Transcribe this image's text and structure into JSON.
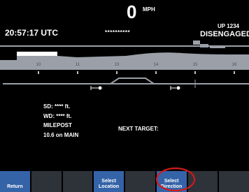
{
  "header": {
    "speed": "0",
    "speed_unit": "MPH",
    "masked_field": "**********",
    "train_id": "UP 1234",
    "utc_time": "20:57:17 UTC",
    "engagement_status": "DISENGAGED"
  },
  "track_view": {
    "mileposts": [
      "10",
      "11",
      "13",
      "14",
      "15",
      "16"
    ]
  },
  "info": {
    "sd": "SD:  **** ft.",
    "wd": "WD:  **** ft.",
    "milepost_label": "MILEPOST",
    "milepost_location": "10.6 on MAIN",
    "next_target": "NEXT TARGET:"
  },
  "softkeys": [
    {
      "line1": "Return",
      "line2": ""
    },
    {
      "line1": "",
      "line2": ""
    },
    {
      "line1": "",
      "line2": ""
    },
    {
      "line1": "Select",
      "line2": "Location"
    },
    {
      "line1": "",
      "line2": ""
    },
    {
      "line1": "Select",
      "line2": "Direction"
    },
    {
      "line1": "",
      "line2": ""
    },
    {
      "line1": "",
      "line2": ""
    }
  ],
  "colors": {
    "background": "#000000",
    "track_band": "#9a9fa8",
    "softkey_active": "#3563a8",
    "softkey_inactive": "#2e3239",
    "annotation_circle": "#d11a1a"
  }
}
